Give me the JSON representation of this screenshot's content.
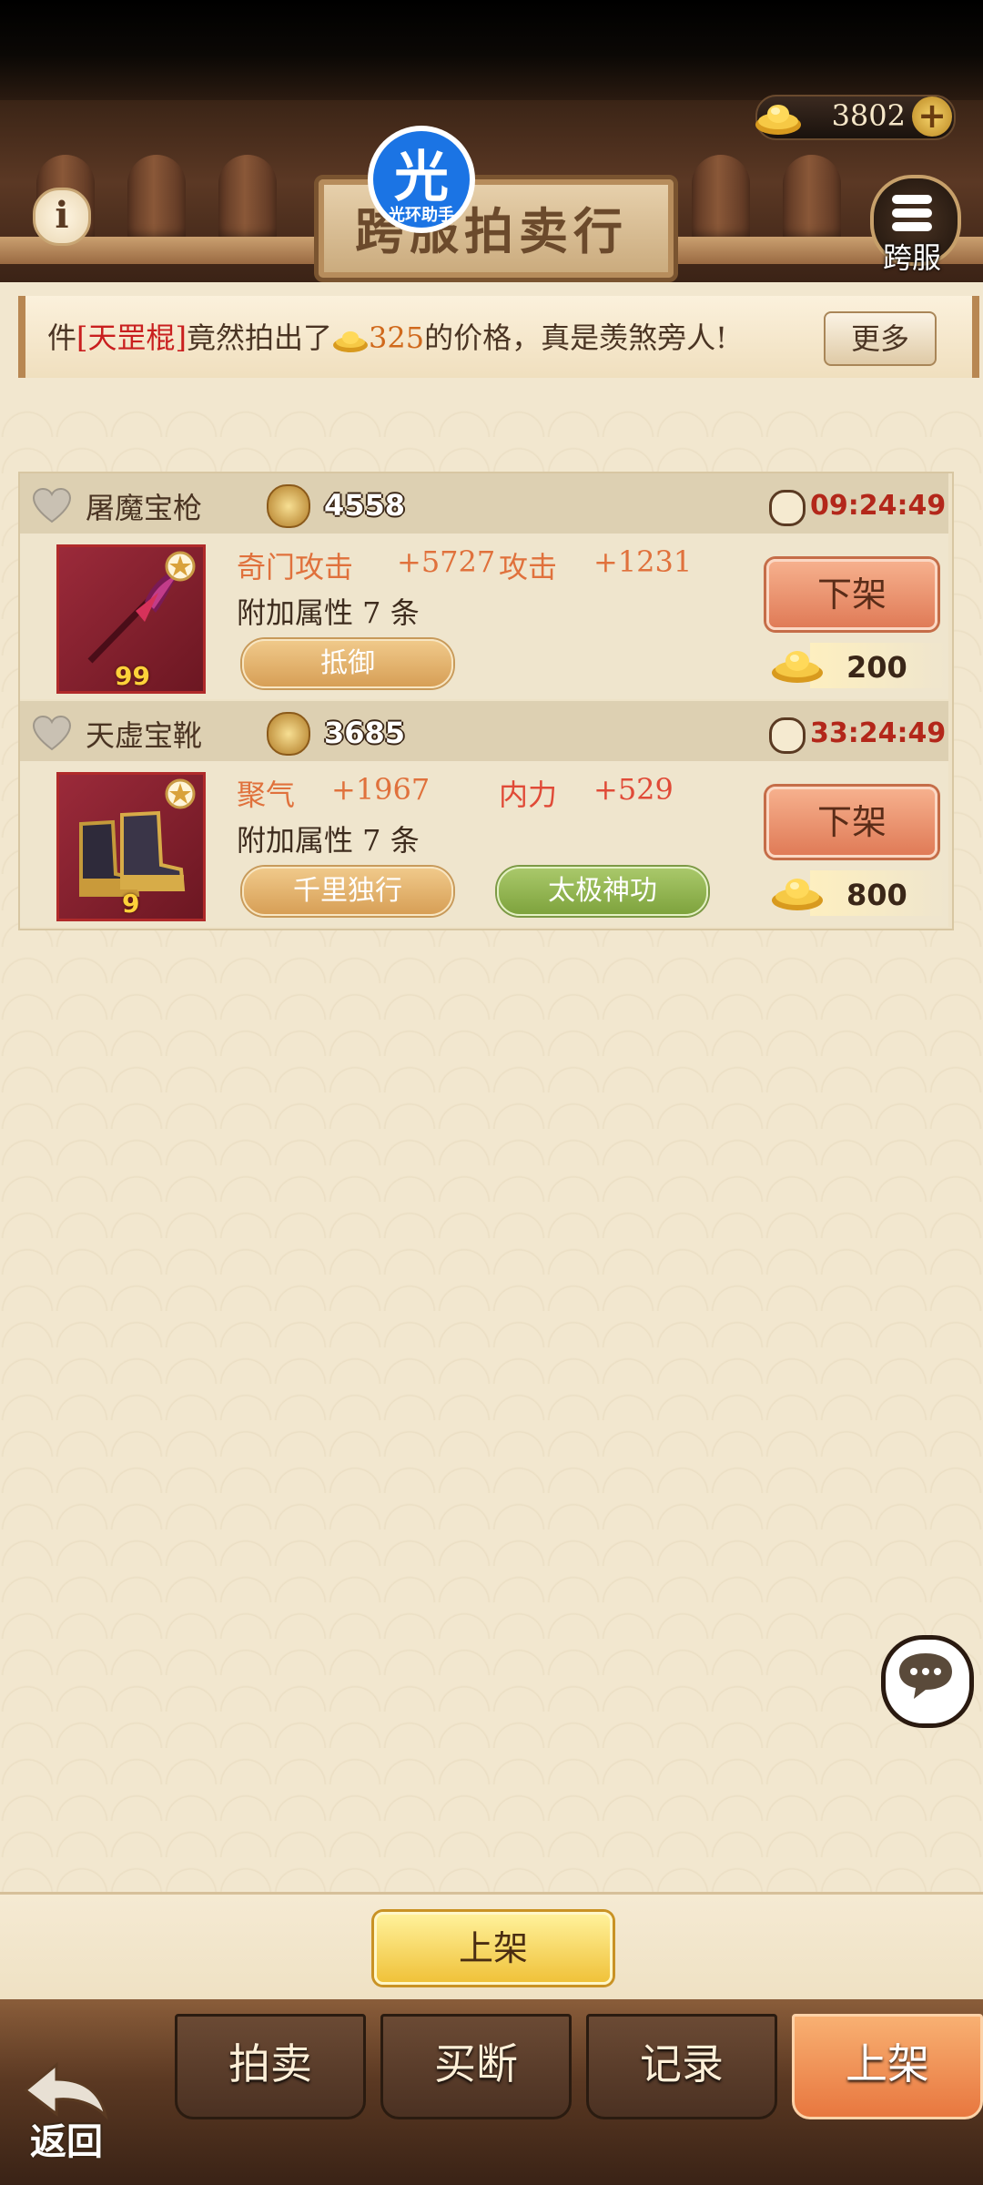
{
  "header": {
    "gold_amount": "3802",
    "plus_icon": "plus-icon",
    "info_label": "i",
    "title": "跨服拍卖行",
    "server_label": "跨服",
    "overlay_char": "光",
    "overlay_label": "光环助手"
  },
  "notice": {
    "prefix": "件",
    "item": "[天罡棍]",
    "middle": "竟然拍出了",
    "price": "325",
    "suffix": "的价格，真是羡煞旁人!",
    "more_label": "更多"
  },
  "listings": [
    {
      "name": "屠魔宝枪",
      "power": "4558",
      "timer": "09:24:49",
      "level": "99",
      "stat1_name": "奇门攻击",
      "stat1_value": "+5727",
      "stat2_name": "攻击",
      "stat2_value": "+1231",
      "extra": "附加属性 7 条",
      "tags": [
        "抵御"
      ],
      "delist_label": "下架",
      "price": "200"
    },
    {
      "name": "天虚宝靴",
      "power": "3685",
      "timer": "33:24:49",
      "level": "9",
      "stat1_name": "聚气",
      "stat1_value": "+1967",
      "stat2_name": "内力",
      "stat2_value": "+529",
      "extra": "附加属性 7 条",
      "tags": [
        "千里独行",
        "太极神功"
      ],
      "delist_label": "下架",
      "price": "800"
    }
  ],
  "actions": {
    "list_item_label": "上架"
  },
  "nav": {
    "tabs": [
      "拍卖",
      "买断",
      "记录",
      "上架"
    ],
    "active_tab": "上架",
    "back_label": "返回"
  },
  "colors": {
    "accent_red": "#b3271a",
    "active_tab": "#e8773f",
    "gold_button": "#f0c23a"
  }
}
